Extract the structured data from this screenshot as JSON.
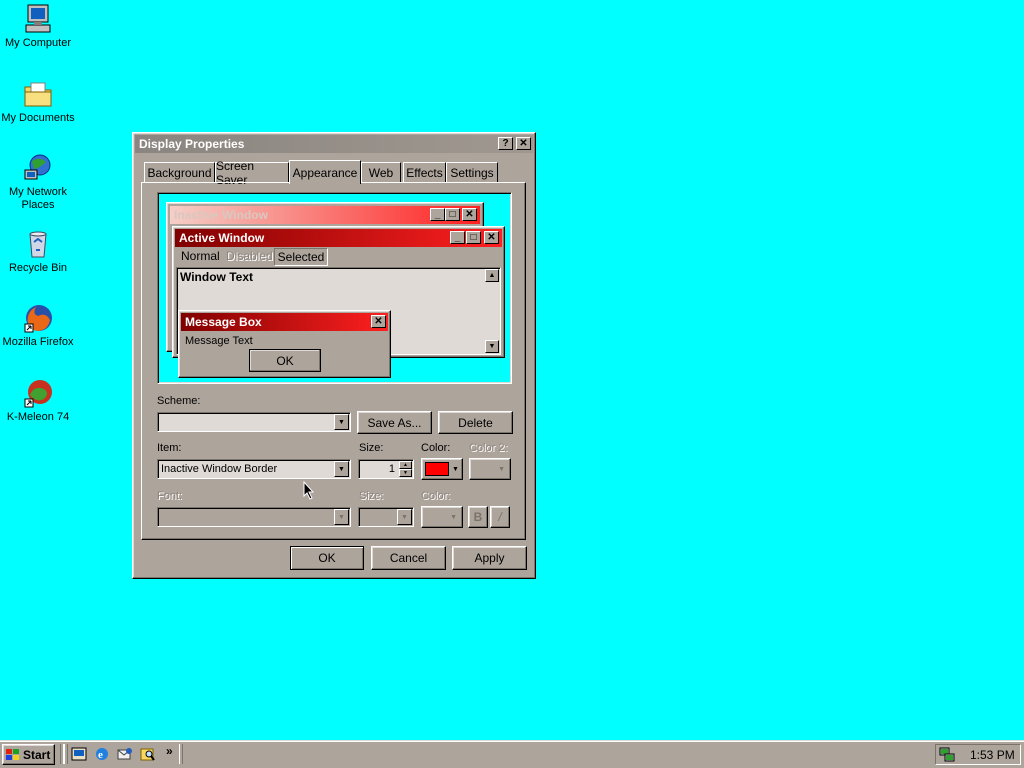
{
  "desktop": {
    "icons": [
      {
        "label": "My Computer"
      },
      {
        "label": "My Documents"
      },
      {
        "label": "My Network Places"
      },
      {
        "label": "Recycle Bin"
      },
      {
        "label": "Mozilla Firefox"
      },
      {
        "label": "K-Meleon 74"
      }
    ]
  },
  "dialog": {
    "title": "Display Properties",
    "help_btn": "?",
    "close_btn": "✕",
    "tabs": [
      "Background",
      "Screen Saver",
      "Appearance",
      "Web",
      "Effects",
      "Settings"
    ],
    "preview": {
      "inactive_title": "Inactive Window",
      "active_title": "Active Window",
      "menu": [
        "Normal",
        "Disabled",
        "Selected"
      ],
      "window_text": "Window Text",
      "msgbox_title": "Message Box",
      "msgbox_text": "Message Text",
      "msgbox_ok": "OK"
    },
    "scheme_label": "Scheme:",
    "scheme_value": "",
    "save_as": "Save As...",
    "delete": "Delete",
    "item_label": "Item:",
    "item_value": "Inactive Window Border",
    "size_label": "Size:",
    "size_value": "1",
    "color_label": "Color:",
    "color2_label": "Color 2:",
    "color_value": "#ff0000",
    "font_label": "Font:",
    "font_size_label": "Size:",
    "font_color_label": "Color:",
    "bold": "B",
    "italic": "/",
    "ok": "OK",
    "cancel": "Cancel",
    "apply": "Apply"
  },
  "taskbar": {
    "start": "Start",
    "more": "»",
    "clock": "1:53 PM"
  },
  "colors": {
    "desktop": "#00ffff",
    "face": "#ada49c",
    "title_active_start": "#800000",
    "title_active_end": "#ff0000"
  }
}
